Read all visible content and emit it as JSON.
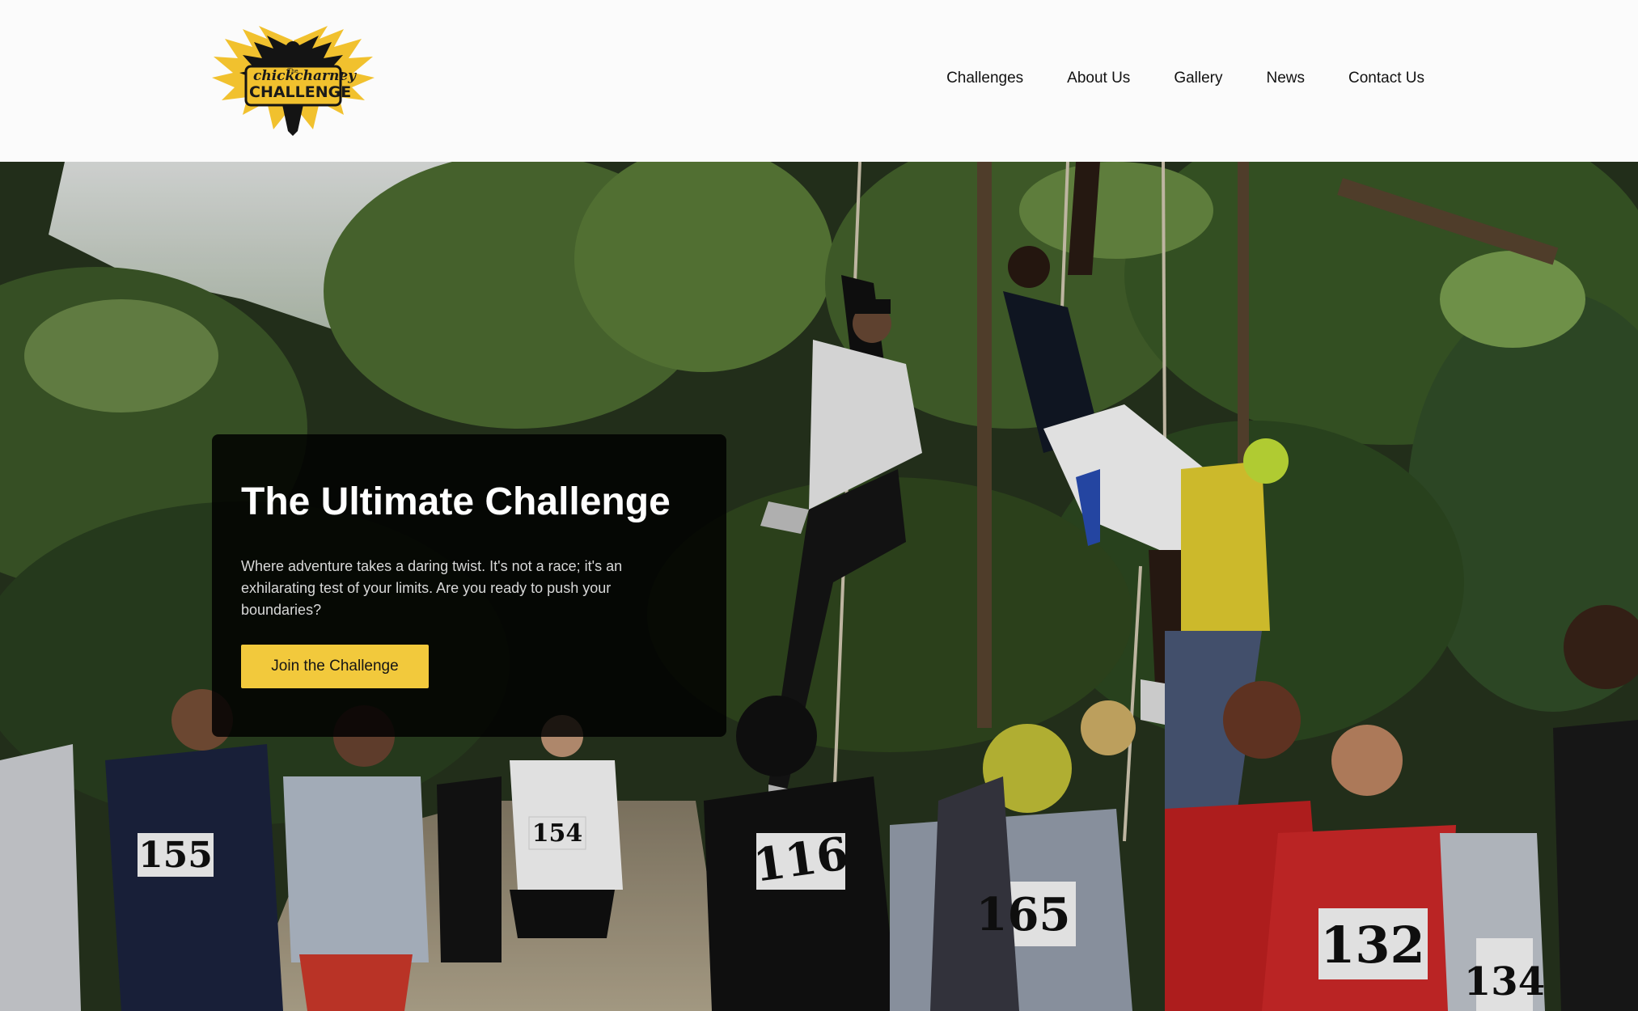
{
  "header": {
    "logo": {
      "small_text": "chickcharney",
      "big_text": "CHALLENGE",
      "tiny_text": "The"
    },
    "nav": [
      {
        "label": "Challenges"
      },
      {
        "label": "About Us"
      },
      {
        "label": "Gallery"
      },
      {
        "label": "News"
      },
      {
        "label": "Contact Us"
      }
    ]
  },
  "hero": {
    "title": "The Ultimate Challenge",
    "text": "Where adventure takes a daring twist. It's not a race; it's an exhilarating test of your limits. Are you ready to push your boundaries?",
    "cta_label": "Join the Challenge",
    "bib_numbers": [
      "155",
      "154",
      "116",
      "165",
      "132",
      "134"
    ]
  },
  "colors": {
    "accent": "#f2c93c",
    "card_bg": "#000000",
    "header_bg": "#fbfbfb"
  }
}
